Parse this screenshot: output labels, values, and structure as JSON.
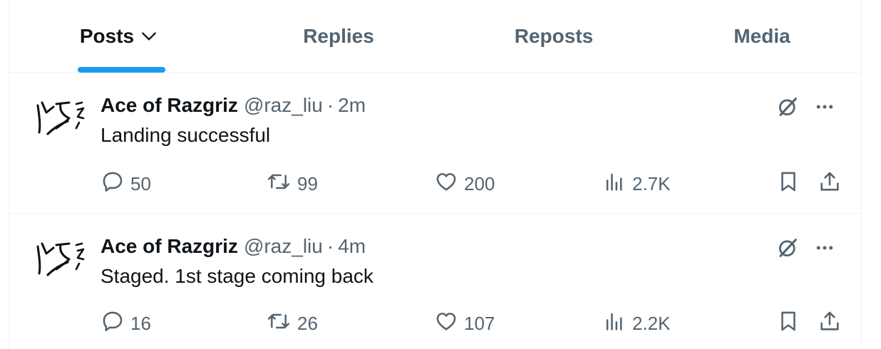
{
  "tabs": [
    {
      "label": "Posts",
      "active": true
    },
    {
      "label": "Replies",
      "active": false
    },
    {
      "label": "Reposts",
      "active": false
    },
    {
      "label": "Media",
      "active": false
    }
  ],
  "posts": [
    {
      "author_name": "Ace of Razgriz",
      "handle": "@raz_liu",
      "separator": "·",
      "time": "2m",
      "text": "Landing successful",
      "replies": "50",
      "reposts": "99",
      "likes": "200",
      "views": "2.7K"
    },
    {
      "author_name": "Ace of Razgriz",
      "handle": "@raz_liu",
      "separator": "·",
      "time": "4m",
      "text": "Staged. 1st stage coming back",
      "replies": "16",
      "reposts": "26",
      "likes": "107",
      "views": "2.2K"
    }
  ],
  "colors": {
    "accent": "#1d9bf0",
    "text_primary": "#0f1419",
    "text_secondary": "#536471",
    "divider": "#eff3f4"
  },
  "icons": {
    "tab_dropdown": "chevron-down-icon",
    "grok": "grok-icon",
    "more": "more-icon",
    "reply": "reply-icon",
    "repost": "repost-icon",
    "like": "heart-icon",
    "views": "views-icon",
    "bookmark": "bookmark-icon",
    "share": "share-icon"
  }
}
